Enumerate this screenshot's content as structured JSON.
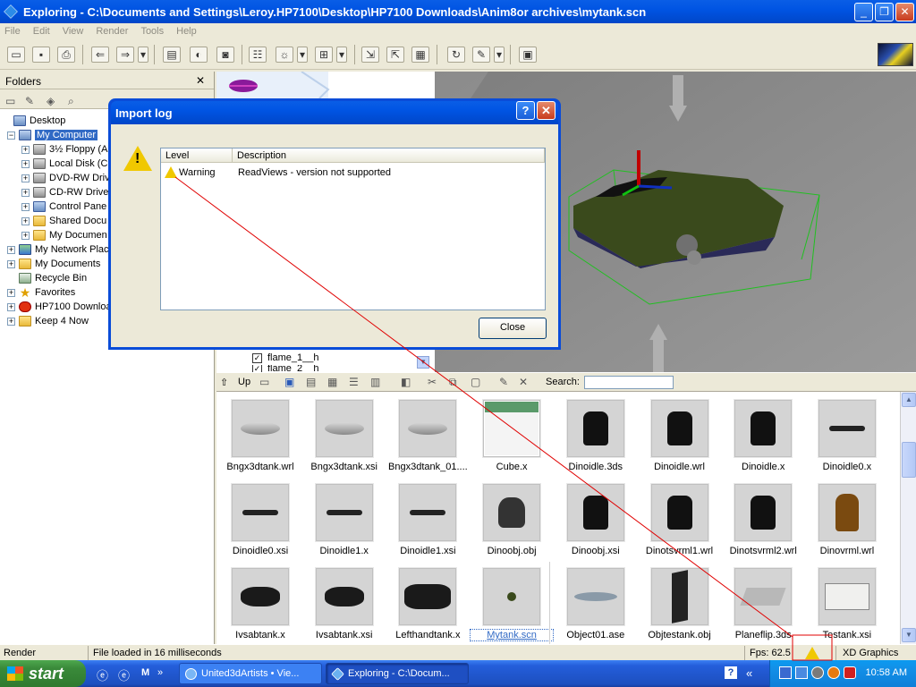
{
  "window": {
    "title": "Exploring - C:\\Documents and Settings\\Leroy.HP7100\\Desktop\\HP7100 Downloads\\Anim8or archives\\mytank.scn",
    "controls": [
      "_",
      "❐",
      "✕"
    ]
  },
  "menu": [
    "File",
    "Edit",
    "View",
    "Render",
    "Tools",
    "Help"
  ],
  "toolbar_icons": [
    "new-icon",
    "save-icon",
    "print-icon",
    "back-icon",
    "forward-icon",
    "dropdown-icon",
    "folder-icon",
    "render-icon",
    "snapshot-icon",
    "properties-icon",
    "light-icon",
    "dropdown-icon",
    "grid-icon",
    "dropdown-icon",
    "import-icon",
    "export-icon",
    "textures-icon",
    "refresh-icon",
    "tools-icon",
    "dropdown-icon",
    "fullscreen-icon"
  ],
  "folders": {
    "header": "Folders",
    "close": "✕",
    "tree": [
      {
        "label": "Desktop",
        "icon": "desktop-icon",
        "expander": "",
        "selected": false
      },
      {
        "label": "My Computer",
        "icon": "computer-icon",
        "expander": "−",
        "selected": true
      },
      {
        "label": "3½ Floppy (A",
        "icon": "floppy-icon",
        "expander": "+",
        "selected": false
      },
      {
        "label": "Local Disk (C",
        "icon": "disk-icon",
        "expander": "+",
        "selected": false
      },
      {
        "label": "DVD-RW Drive",
        "icon": "dvd-icon",
        "expander": "+",
        "selected": false
      },
      {
        "label": "CD-RW Drive",
        "icon": "cd-icon",
        "expander": "+",
        "selected": false
      },
      {
        "label": "Control Pane",
        "icon": "control-panel-icon",
        "expander": "+",
        "selected": false
      },
      {
        "label": "Shared Docu",
        "icon": "folder-icon",
        "expander": "+",
        "selected": false
      },
      {
        "label": "My Documen",
        "icon": "folder-icon",
        "expander": "+",
        "selected": false
      },
      {
        "label": "My Network Place",
        "icon": "network-icon",
        "expander": "+",
        "selected": false
      },
      {
        "label": "My Documents",
        "icon": "folder-icon",
        "expander": "+",
        "selected": false
      },
      {
        "label": "Recycle Bin",
        "icon": "recycle-bin-icon",
        "expander": "",
        "selected": false
      },
      {
        "label": "Favorites",
        "icon": "star-icon",
        "expander": "+",
        "selected": false
      },
      {
        "label": "HP7100 Downloa",
        "icon": "hp-icon",
        "expander": "+",
        "selected": false
      },
      {
        "label": "Keep 4 Now",
        "icon": "folder-icon",
        "expander": "+",
        "selected": false
      }
    ]
  },
  "outline": {
    "items": [
      "flame_1__h",
      "flame_2__h"
    ]
  },
  "lower_toolbar": {
    "up_label": "Up",
    "search_label": "Search:",
    "search_value": ""
  },
  "files": [
    {
      "name": "Bngx3dtank.wrl",
      "thumb": "tank"
    },
    {
      "name": "Bngx3dtank.xsi",
      "thumb": "tank"
    },
    {
      "name": "Bngx3dtank_01....",
      "thumb": "tank"
    },
    {
      "name": "Cube.x",
      "thumb": "cube"
    },
    {
      "name": "Dinoidle.3ds",
      "thumb": "dino"
    },
    {
      "name": "Dinoidle.wrl",
      "thumb": "dino"
    },
    {
      "name": "Dinoidle.x",
      "thumb": "dino"
    },
    {
      "name": "Dinoidle0.x",
      "thumb": "bird"
    },
    {
      "name": "Dinoidle0.xsi",
      "thumb": "bird"
    },
    {
      "name": "Dinoidle1.x",
      "thumb": "bird"
    },
    {
      "name": "Dinoidle1.xsi",
      "thumb": "bird"
    },
    {
      "name": "Dinoobj.obj",
      "thumb": "spider"
    },
    {
      "name": "Dinoobj.xsi",
      "thumb": "dino"
    },
    {
      "name": "Dinotsvrml1.wrl",
      "thumb": "dino"
    },
    {
      "name": "Dinotsvrml2.wrl",
      "thumb": "dino"
    },
    {
      "name": "Dinovrml.wrl",
      "thumb": "dino-brown"
    },
    {
      "name": "Ivsabtank.x",
      "thumb": "tank-dark"
    },
    {
      "name": "Ivsabtank.xsi",
      "thumb": "tank-dark"
    },
    {
      "name": "Lefthandtank.x",
      "thumb": "tank-big"
    },
    {
      "name": "Mytank.scn",
      "thumb": "dot",
      "selected": true
    },
    {
      "name": "Object01.ase",
      "thumb": "disc"
    },
    {
      "name": "Objtestank.obj",
      "thumb": "slab"
    },
    {
      "name": "Planeflip.3ds",
      "thumb": "plane"
    },
    {
      "name": "Testank.xsi",
      "thumb": "paper"
    }
  ],
  "status": {
    "left": "Render",
    "message": "File loaded in 16 milliseconds",
    "fps": "Fps: 62.5",
    "graphics": "XD Graphics"
  },
  "taskbar": {
    "start": "start",
    "tasks": [
      "United3dArtists • Vie...",
      "Exploring - C:\\Docum..."
    ],
    "clock": "10:58 AM"
  },
  "dialog": {
    "title": "Import log",
    "columns": [
      "Level",
      "Description"
    ],
    "rows": [
      {
        "level": "Warning",
        "description": "ReadViews - version not supported"
      }
    ],
    "close": "Close",
    "help": "?",
    "x": "✕"
  },
  "colors": {
    "xp_blue": "#0054e3",
    "viewport_gray": "#8c8c8c",
    "tank_green": "#3a4a1c",
    "annotation_red": "#e00000"
  }
}
